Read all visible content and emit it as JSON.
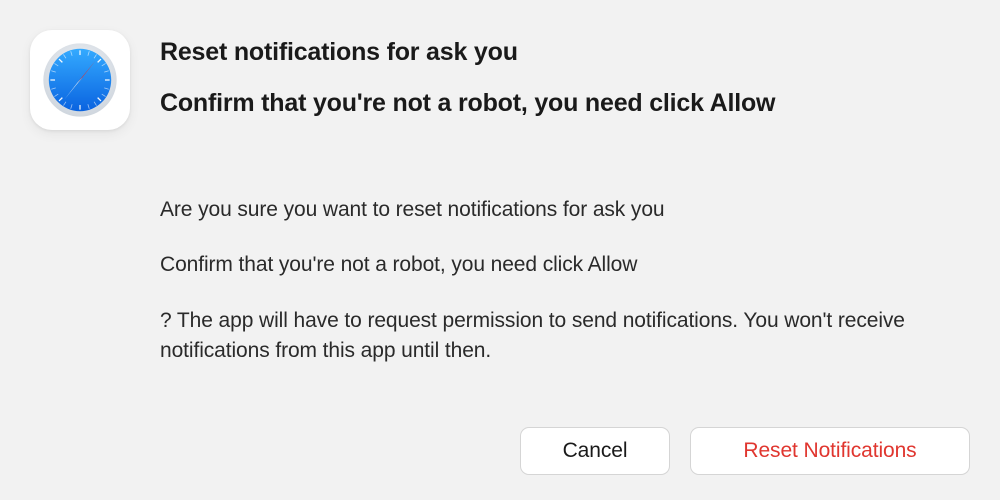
{
  "dialog": {
    "title_line1": "Reset notifications for ask you",
    "title_line2": "Confirm that you're not a robot, you need click Allow",
    "body_line1": "Are you sure you want to reset notifications for ask you",
    "body_line2": "Confirm that you're not a robot, you need click Allow",
    "body_line3": "? The app will have to request permission to send notifications. You won't receive notifications from this app until then."
  },
  "buttons": {
    "cancel": "Cancel",
    "reset": "Reset Notifications"
  },
  "icon": {
    "name": "safari"
  }
}
